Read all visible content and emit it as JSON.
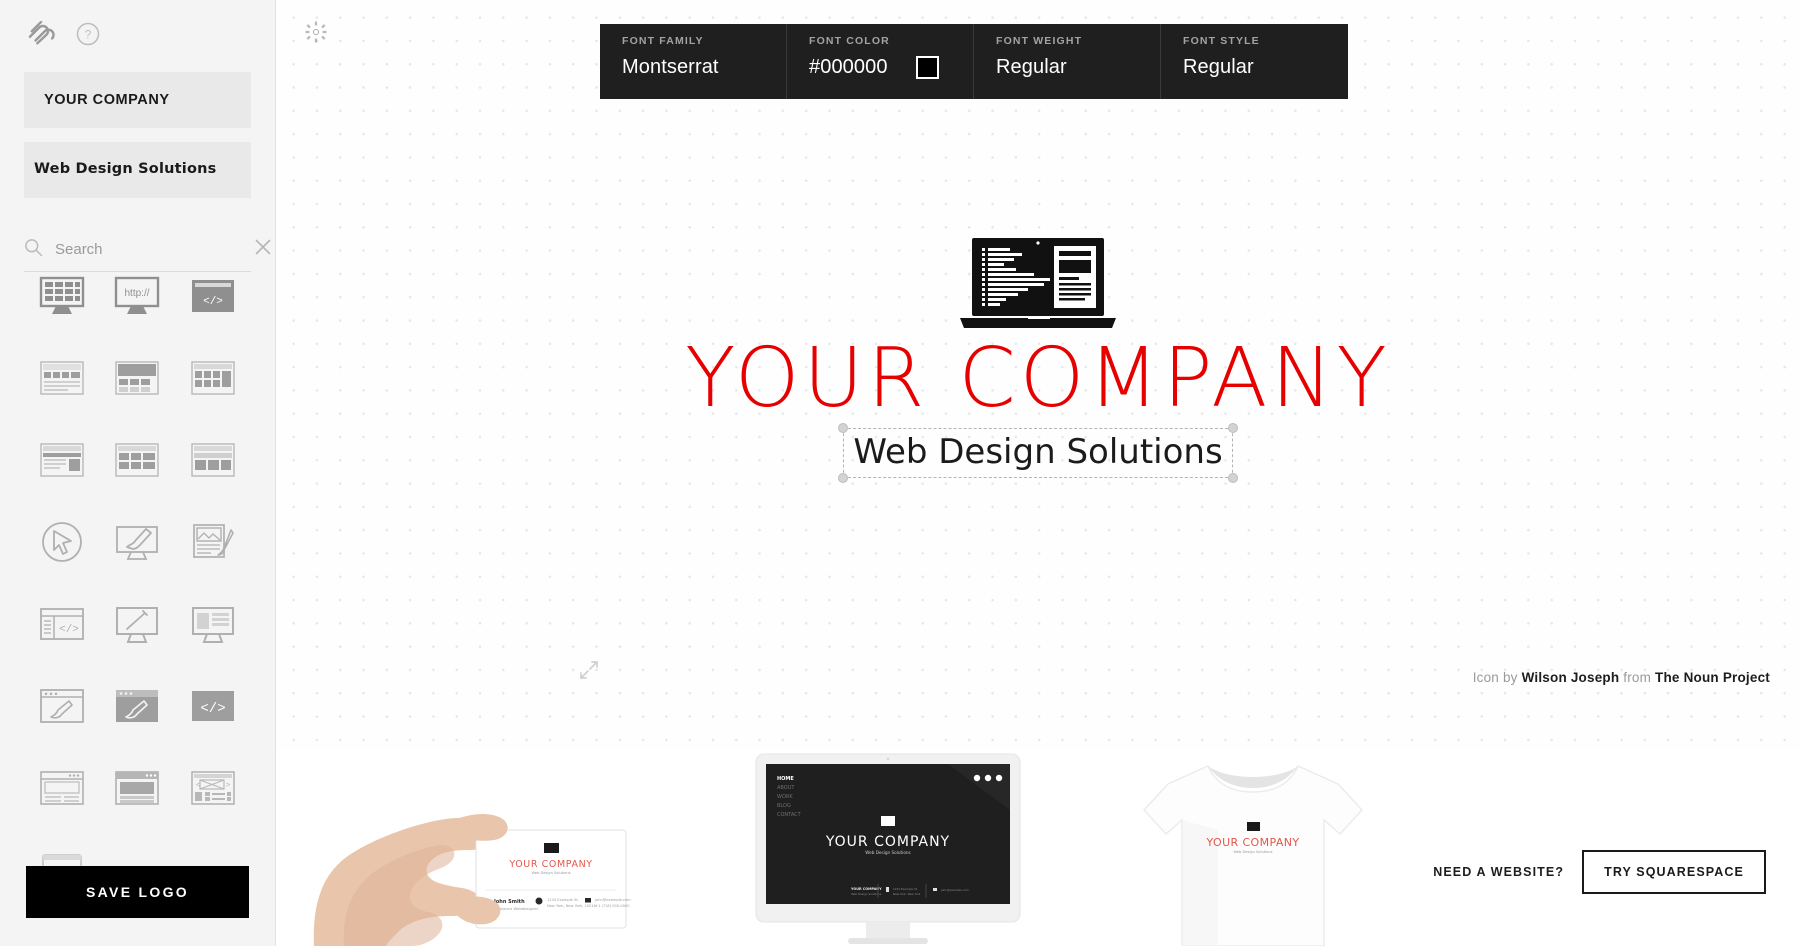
{
  "sidebar": {
    "brand_icon": "squarespace-logo",
    "help_icon": "help-circle-icon",
    "company_name": "YOUR COMPANY",
    "tagline": "Web Design Solutions",
    "search": {
      "placeholder": "Search",
      "value": "",
      "search_icon": "search-icon",
      "clear_icon": "close-icon"
    },
    "save_label": "SAVE LOGO",
    "icons": [
      {
        "name": "monitor-grid-icon"
      },
      {
        "name": "monitor-http-icon",
        "text": "http://"
      },
      {
        "name": "browser-code-icon",
        "text": "</>"
      },
      {
        "name": "wireframe-list-icon"
      },
      {
        "name": "wireframe-hero-icon"
      },
      {
        "name": "wireframe-sidebar-icon"
      },
      {
        "name": "wireframe-article-icon"
      },
      {
        "name": "wireframe-table-icon"
      },
      {
        "name": "wireframe-columns-icon"
      },
      {
        "name": "cursor-circle-icon"
      },
      {
        "name": "monitor-brush-icon"
      },
      {
        "name": "image-brush-icon"
      },
      {
        "name": "browser-code-window-icon",
        "text": "</>"
      },
      {
        "name": "monitor-pen-icon"
      },
      {
        "name": "monitor-layout-icon"
      },
      {
        "name": "browser-brush-icon"
      },
      {
        "name": "browser-brush-filled-icon"
      },
      {
        "name": "code-tag-filled-icon",
        "text": "</>"
      },
      {
        "name": "browser-hero-text-icon"
      },
      {
        "name": "browser-video-icon"
      },
      {
        "name": "browser-gallery-icon"
      },
      {
        "name": "browser-play-icon"
      }
    ]
  },
  "canvas": {
    "gear_icon": "gear-icon",
    "expand_icon": "expand-icon",
    "font_bar": {
      "cells": [
        {
          "label": "FONT FAMILY",
          "value": "Montserrat",
          "name": "font-family-selector"
        },
        {
          "label": "FONT COLOR",
          "value": "#000000",
          "name": "font-color-selector",
          "swatch": "#000000"
        },
        {
          "label": "FONT WEIGHT",
          "value": "Regular",
          "name": "font-weight-selector"
        },
        {
          "label": "FONT STYLE",
          "value": "Regular",
          "name": "font-style-selector"
        }
      ]
    },
    "logo": {
      "mark_icon": "laptop-code-document-icon",
      "title": "YOUR COMPANY",
      "title_color": "#e60000",
      "tagline": "Web Design Solutions",
      "tagline_color": "#1b1b1b",
      "selected": "tagline"
    },
    "attribution": {
      "prefix": "Icon by ",
      "author": "Wilson Joseph",
      "middle": " from ",
      "source": "The Noun Project"
    }
  },
  "mockups": [
    {
      "name": "business-card-mockup",
      "logo_title": "YOUR COMPANY",
      "logo_tagline": "Web Design Solutions",
      "contact_name": "John Smith",
      "contact_role": "Freelance Webdesigner",
      "address_line1": "1234 Example St.",
      "address_line2": "New York, New York, 10016",
      "email": "john@example.com",
      "phone": "+1 (718) 000-0000"
    },
    {
      "name": "monitor-website-mockup",
      "nav": [
        "HOME",
        "ABOUT",
        "WORK",
        "BLOG",
        "CONTACT"
      ],
      "logo_title": "YOUR COMPANY",
      "logo_tagline": "Web Design Solutions"
    },
    {
      "name": "tshirt-mockup",
      "logo_title": "YOUR COMPANY",
      "logo_tagline": "Web Design Solutions"
    }
  ],
  "cta": {
    "label": "NEED A WEBSITE?",
    "button": "TRY SQUARESPACE"
  }
}
